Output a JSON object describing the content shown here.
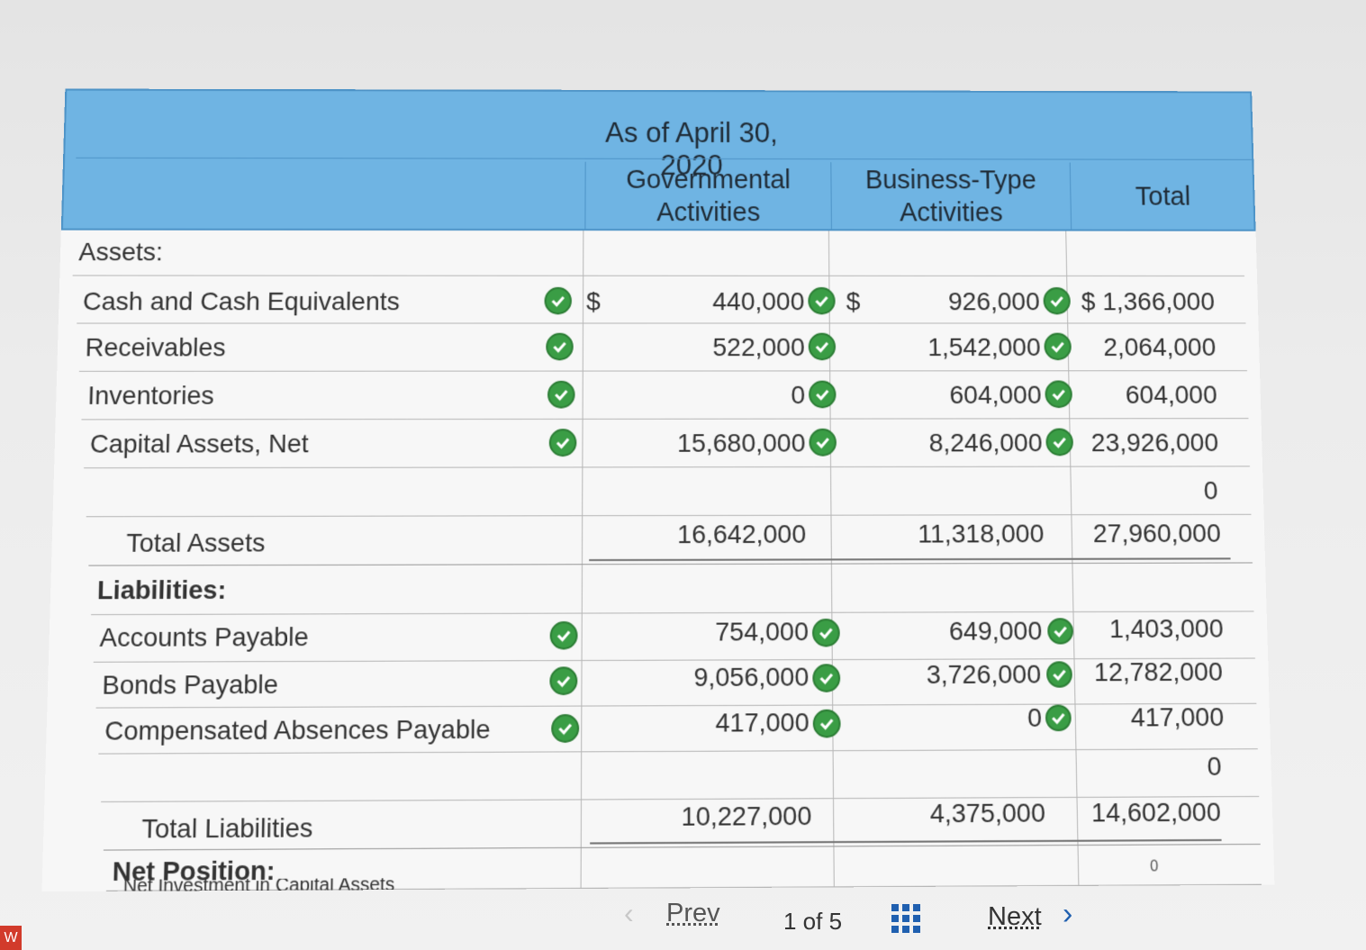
{
  "header": {
    "date": "As of April 30, 2020",
    "columns": [
      "Governmental\nActivities",
      "Business-Type\nActivities",
      "Total"
    ]
  },
  "sections": {
    "assets": "Assets:",
    "liabilities": "Liabilities:",
    "net_position": "Net Position:"
  },
  "assets": [
    {
      "label": "Cash and Cash Equivalents",
      "gov": "440,000",
      "bus": "926,000",
      "total": "$ 1,366,000"
    },
    {
      "label": "Receivables",
      "gov": "522,000",
      "bus": "1,542,000",
      "total": "2,064,000"
    },
    {
      "label": "Inventories",
      "gov": "0",
      "bus": "604,000",
      "total": "604,000"
    },
    {
      "label": "Capital Assets, Net",
      "gov": "15,680,000",
      "bus": "8,246,000",
      "total": "23,926,000"
    }
  ],
  "assets_blank_total": "0",
  "total_assets": {
    "label": "Total Assets",
    "gov": "16,642,000",
    "bus": "11,318,000",
    "total": "27,960,000"
  },
  "liabilities": [
    {
      "label": "Accounts Payable",
      "gov": "754,000",
      "bus": "649,000",
      "total": "1,403,000"
    },
    {
      "label": "Bonds Payable",
      "gov": "9,056,000",
      "bus": "3,726,000",
      "total": "12,782,000"
    },
    {
      "label": "Compensated Absences Payable",
      "gov": "417,000",
      "bus": "0",
      "total": "417,000"
    }
  ],
  "liabilities_blank_total": "0",
  "total_liabilities": {
    "label": "Total Liabilities",
    "gov": "10,227,000",
    "bus": "4,375,000",
    "total": "14,602,000"
  },
  "net_position_first_row": {
    "label": "Net Investment in Capital Assets",
    "total": "0"
  },
  "currency_symbol": "$",
  "footer": {
    "prev": "Prev",
    "pager": "1 of 5",
    "next": "Next"
  },
  "colors": {
    "header_bg": "#6fb4e3",
    "check_green": "#3a9d45",
    "link_blue": "#2060b0"
  }
}
